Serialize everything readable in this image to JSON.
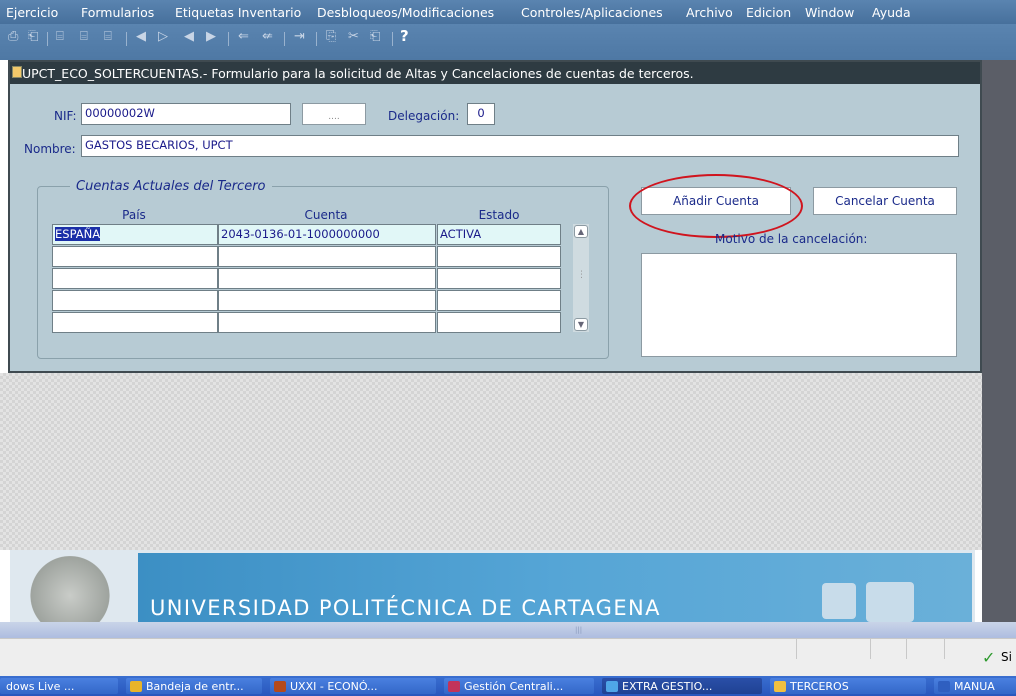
{
  "menu": [
    {
      "label": "Ejercicio"
    },
    {
      "label": "Formularios"
    },
    {
      "label": "Etiquetas Inventario"
    },
    {
      "label": "Desbloqueos/Modificaciones"
    },
    {
      "label": "Controles/Aplicaciones"
    },
    {
      "label": "Archivo"
    },
    {
      "label": "Edicion"
    },
    {
      "label": "Window"
    },
    {
      "label": "Ayuda"
    }
  ],
  "toolbar": {
    "help_glyph": "?"
  },
  "form": {
    "title": "UPCT_ECO_SOLTERCUENTAS.- Formulario para la solicitud de Altas y Cancelaciones de cuentas de terceros.",
    "nif_label": "NIF:",
    "nif_value": "00000002W",
    "lov_button": "....",
    "delegacion_label": "Delegación:",
    "delegacion_value": "0",
    "nombre_label": "Nombre:",
    "nombre_value": "GASTOS BECARIOS, UPCT",
    "group_title": "Cuentas Actuales del Tercero",
    "columns": [
      "País",
      "Cuenta",
      "Estado"
    ],
    "rows": [
      {
        "pais": "ESPAÑA",
        "cuenta": "2043-0136-01-1000000000",
        "estado": "ACTIVA"
      },
      {
        "pais": "",
        "cuenta": "",
        "estado": ""
      },
      {
        "pais": "",
        "cuenta": "",
        "estado": ""
      },
      {
        "pais": "",
        "cuenta": "",
        "estado": ""
      },
      {
        "pais": "",
        "cuenta": "",
        "estado": ""
      }
    ],
    "add_button": "Añadir Cuenta",
    "cancel_button": "Cancelar Cuenta",
    "motivo_label": "Motivo de la cancelación:",
    "motivo_value": ""
  },
  "banner": {
    "text": "UNIVERSIDAD POLITÉCNICA DE CARTAGENA"
  },
  "status": {
    "right_text": "Si"
  },
  "taskbar": [
    {
      "label": "dows Live ...",
      "color": "#2e9c3a"
    },
    {
      "label": "Bandeja de entr...",
      "color": "#e8b42a"
    },
    {
      "label": "UXXI - ECONÓ...",
      "color": "#b54a1c"
    },
    {
      "label": "Gestión Centrali...",
      "color": "#c2335a"
    },
    {
      "label": "EXTRA GESTIO...",
      "color": "#4fa6e8"
    },
    {
      "label": "TERCEROS",
      "color": "#f0c040"
    },
    {
      "label": "MANUA",
      "color": "#2f5fc0"
    }
  ]
}
